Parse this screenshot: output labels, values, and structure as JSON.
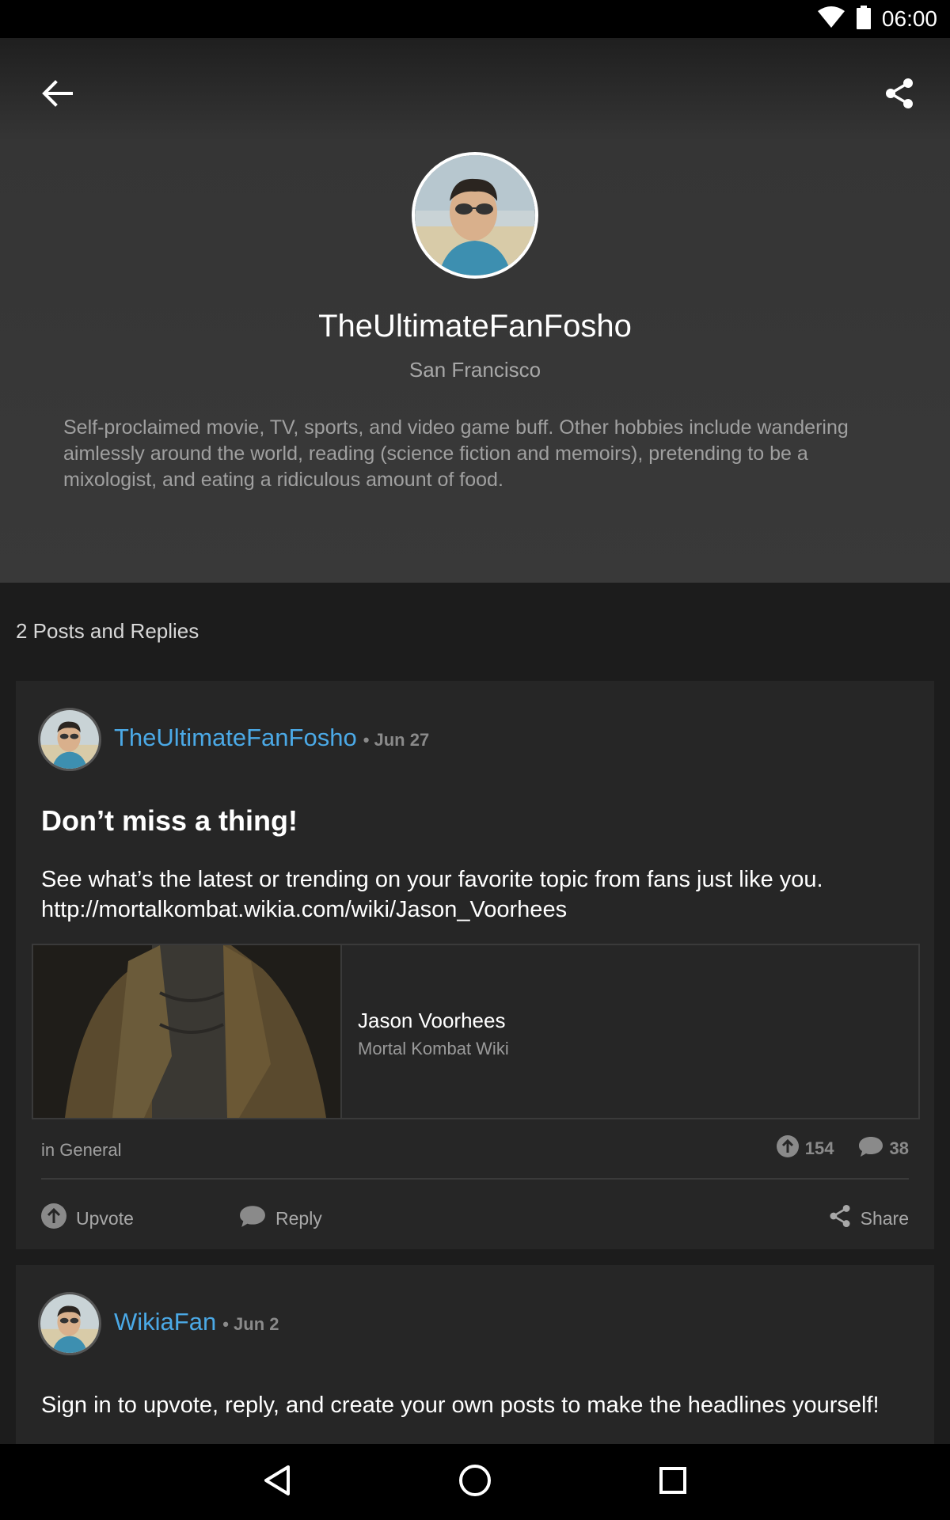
{
  "status_bar": {
    "time": "06:00",
    "icons": [
      "wifi-icon",
      "battery-icon"
    ]
  },
  "toolbar": {
    "back_icon": "arrow-left-icon",
    "share_icon": "share-icon"
  },
  "profile": {
    "name": "TheUltimateFanFosho",
    "location": "San Francisco",
    "bio": "Self-proclaimed movie, TV, sports, and video game buff. Other hobbies include wandering aimlessly around the world, reading (science fiction and memoirs), pretending to be a mixologist, and eating a ridiculous amount of food."
  },
  "feed": {
    "title": "2 Posts and Replies",
    "posts": [
      {
        "author": "TheUltimateFanFosho",
        "date": "• Jun 27",
        "title": "Don’t miss a thing!",
        "body_line1": "See what’s the latest or trending on your favorite topic from fans just like you.",
        "body_line2": "http://mortalkombat.wikia.com/wiki/Jason_Voorhees",
        "link_preview": {
          "title": "Jason Voorhees",
          "source": "Mortal Kombat Wiki"
        },
        "category": "in General",
        "upvotes": "154",
        "replies": "38",
        "actions": {
          "upvote": "Upvote",
          "reply": "Reply",
          "share": "Share"
        }
      },
      {
        "author": "WikiaFan",
        "date": "• Jun 2",
        "body": "Sign in to upvote, reply, and create your own posts to make the headlines yourself!"
      }
    ]
  },
  "colors": {
    "accent": "#4ba9e6",
    "background": "#1c1c1c",
    "card": "#262626",
    "header": "#393939"
  },
  "nav_bar": {
    "icons": [
      "nav-back-icon",
      "nav-home-icon",
      "nav-recents-icon"
    ]
  }
}
